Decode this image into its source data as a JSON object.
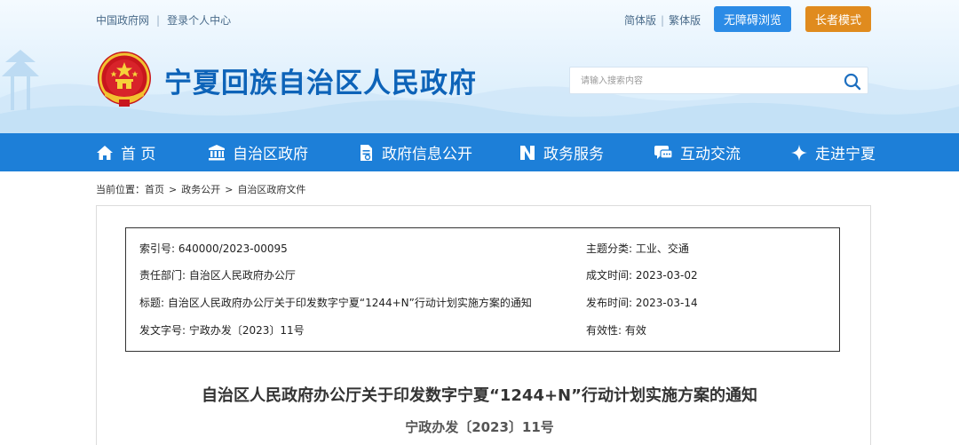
{
  "header": {
    "links": {
      "gov_portal": "中国政府网",
      "separator": "|",
      "login": "登录个人中心"
    },
    "lang": {
      "simplified": "简体版",
      "separator": "|",
      "traditional": "繁体版"
    },
    "accessibility_button": "无障碍浏览",
    "elder_mode_button": "长者模式",
    "site_title": "宁夏回族自治区人民政府",
    "search": {
      "placeholder": "请输入搜索内容"
    }
  },
  "nav": {
    "items": [
      {
        "label": "首 页",
        "icon": "home-icon"
      },
      {
        "label": "自治区政府",
        "icon": "government-building-icon"
      },
      {
        "label": "政府信息公开",
        "icon": "document-icon"
      },
      {
        "label": "政务服务",
        "icon": "service-n-icon"
      },
      {
        "label": "互动交流",
        "icon": "chat-icon"
      },
      {
        "label": "走进宁夏",
        "icon": "sparkle-icon"
      }
    ]
  },
  "breadcrumb": {
    "prefix": "当前位置：",
    "items": [
      "首页",
      "政务公开",
      "自治区政府文件"
    ],
    "arrow": ">"
  },
  "meta": {
    "index_label": "索引号:",
    "index_value": "640000/2023-00095",
    "topic_label": "主题分类:",
    "topic_value": "工业、交通",
    "dept_label": "责任部门:",
    "dept_value": "自治区人民政府办公厅",
    "created_label": "成文时间:",
    "created_value": "2023-03-02",
    "title_label": "标题:",
    "title_value": "自治区人民政府办公厅关于印发数字宁夏“1244+N”行动计划实施方案的通知",
    "published_label": "发布时间:",
    "published_value": "2023-03-14",
    "docnum_label": "发文字号:",
    "docnum_value": "宁政办发〔2023〕11号",
    "validity_label": "有效性:",
    "validity_value": "有效"
  },
  "document": {
    "title": "自治区人民政府办公厅关于印发数字宁夏“1244+N”行动计划实施方案的通知",
    "number": "宁政办发〔2023〕11号"
  },
  "colors": {
    "nav_blue": "#1d7fd8",
    "title_blue": "#0d63b8",
    "access_button": "#2b8be6",
    "elder_button": "#e08b1e"
  }
}
